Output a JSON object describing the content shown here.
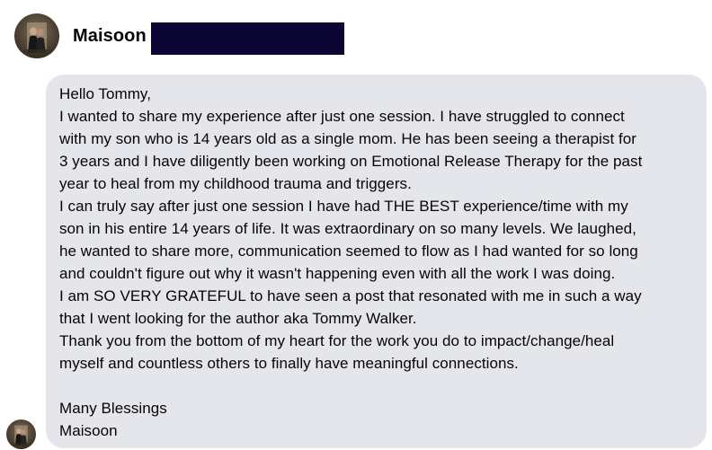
{
  "conversation": {
    "sender_name": "Maisoon",
    "avatar_icon": "profile-photo-avatar",
    "redaction_color": "#0b0533",
    "bubble_color": "#e4e6eb"
  },
  "message": {
    "lines": [
      "Hello Tommy,",
      "I wanted to share my experience after just one session. I have struggled to connect",
      "with my son who is 14 years old as a single mom. He has been seeing a therapist for",
      "3 years and I have diligently been working on Emotional Release Therapy for the past",
      "year to heal from my childhood trauma and triggers.",
      "I can truly say after just one session I have had THE BEST experience/time with my",
      "son in his entire 14 years of life. It was extraordinary on so many levels. We laughed,",
      "he wanted to share more, communication seemed to flow as I had wanted for so long",
      "and couldn't figure out why it wasn't happening even with all the work I was doing.",
      "I am SO VERY GRATEFUL to have seen a post that resonated with me in such a way",
      "that I went looking for the author aka Tommy Walker.",
      "Thank you from the bottom of my heart for the work you do to impact/change/heal",
      "myself and countless others to finally have meaningful connections."
    ],
    "closing": "Many Blessings",
    "signature": "Maisoon"
  }
}
